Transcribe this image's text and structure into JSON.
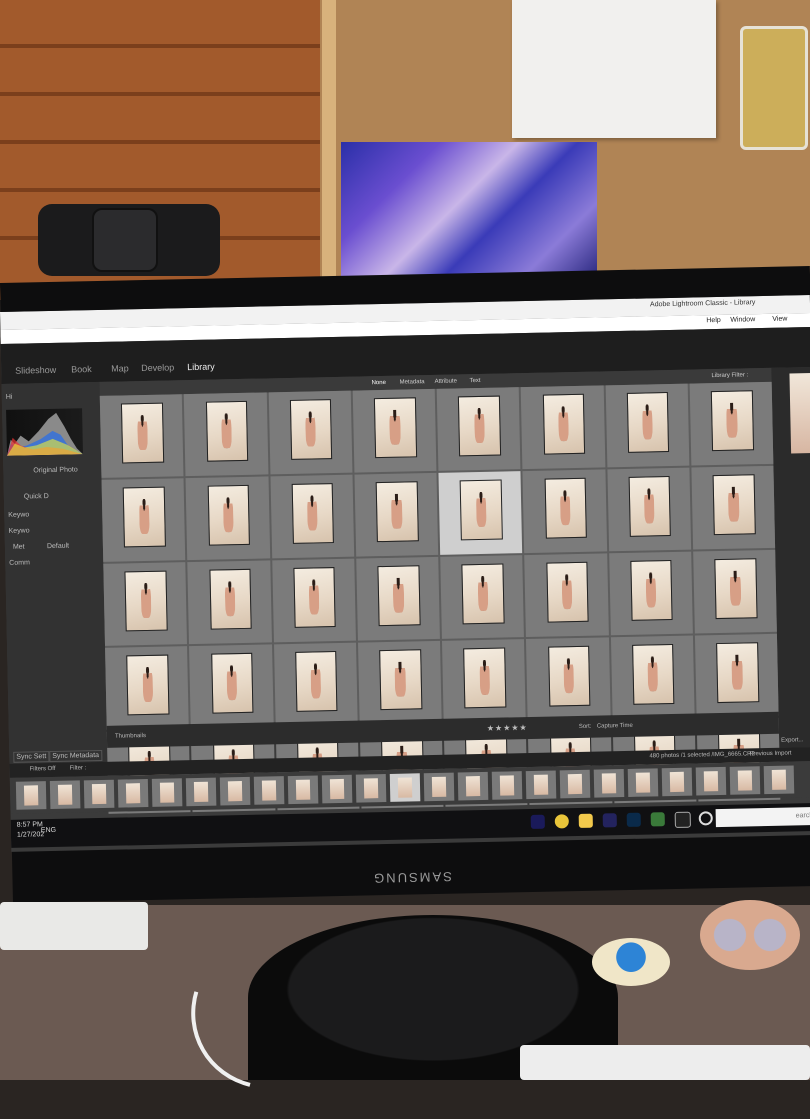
{
  "app": {
    "title": "Adobe Lightroom Classic - Library",
    "menu": [
      "Help",
      "Window",
      "View"
    ],
    "modules": [
      "Library",
      "Develop",
      "Map",
      "Book",
      "Slideshow"
    ],
    "active_module": "Library"
  },
  "library_filter": {
    "label": "Library Filter :",
    "tabs": [
      "Text",
      "Attribute",
      "Metadata",
      "None"
    ],
    "active_tab": "None"
  },
  "left_panel": {
    "histogram_label": "Hi",
    "original_photo_label": "Original Photo",
    "sections": [
      "Quick D",
      "Keywo",
      "Keywo",
      "Met",
      "Comm"
    ],
    "default_label": "Default",
    "sync_metadata": "Sync Metadata",
    "sync_settings": "Sync Sett"
  },
  "toolbar": {
    "sort_label": "Sort:",
    "sort_value": "Capture Time",
    "thumbnails_label": "Thumbnails",
    "export_label": "Export..."
  },
  "filmstrip": {
    "info": "480 photos /1 selected /IMG_6665.CR2",
    "source": "Previous Import",
    "filter_label": "Filter :",
    "filter_value": "Filters Off"
  },
  "taskbar": {
    "search_placeholder": "earch",
    "lang": "ENG",
    "time": "8:57 PM",
    "date": "1/27/202"
  },
  "monitor_brand": "SAMSUNG",
  "grid": {
    "rows": 5,
    "cols": 8,
    "selected_index": 12
  },
  "icons": [
    "lightroom-icon",
    "chrome-icon",
    "explorer-icon",
    "premiere-icon",
    "photoshop-icon",
    "task-view-icon",
    "cortana-icon"
  ]
}
